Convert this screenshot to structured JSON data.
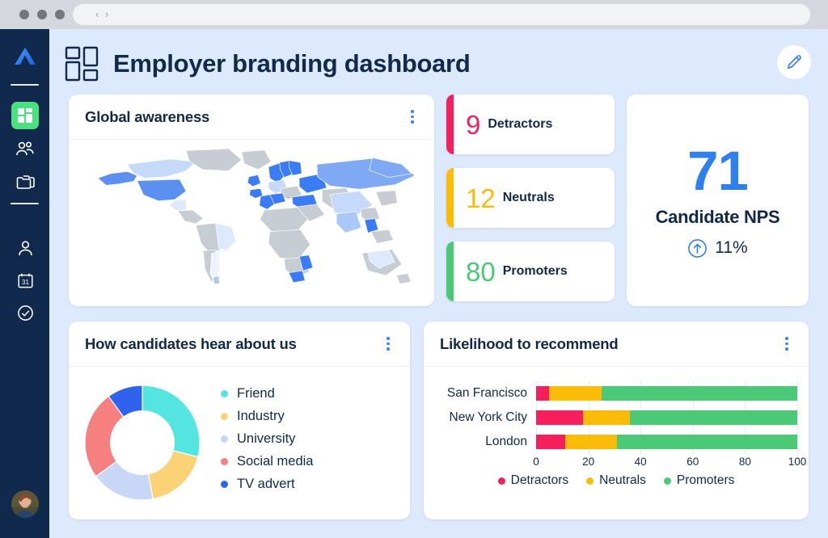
{
  "browser": {
    "nav_chevrons": "‹ ›",
    "window_dots": 3
  },
  "sidebar": {
    "logo_name": "app-logo",
    "items": [
      {
        "icon": "dashboard-grid-icon",
        "name": "dashboard",
        "active": true
      },
      {
        "icon": "people-icon",
        "name": "people",
        "active": false
      },
      {
        "icon": "folders-icon",
        "name": "folders",
        "active": false
      },
      {
        "icon": "person-icon",
        "name": "profile",
        "active": false
      },
      {
        "icon": "calendar-icon",
        "name": "calendar",
        "calendar_day": "31",
        "active": false
      },
      {
        "icon": "check-circle-icon",
        "name": "tasks",
        "active": false
      }
    ],
    "avatar_alt": "user-avatar"
  },
  "header": {
    "title": "Employer branding dashboard",
    "icon": "dashboard-grid-icon",
    "edit_icon": "pencil-icon"
  },
  "colors": {
    "detractors": "#f5록",
    "detractors_hex": "#f51f5e",
    "neutrals_hex": "#fbbc09",
    "promoters_hex": "#4cc977",
    "accent_blue": "#2f80ed",
    "navy": "#11294d",
    "canvas_bg": "#dde9fc",
    "sidebar_bg": "#11294d",
    "active_green": "#4ae07f"
  },
  "cards": {
    "global_awareness": {
      "title": "Global awareness",
      "menu": "kebab-menu"
    },
    "nps_summary": {
      "score": "71",
      "label": "Candidate NPS",
      "trend_icon": "arrow-up-circle-icon",
      "trend_value": "11%"
    },
    "hear_about_us": {
      "title": "How candidates hear about us",
      "menu": "kebab-menu"
    },
    "likelihood": {
      "title": "Likelihood to recommend",
      "menu": "kebab-menu"
    }
  },
  "nps_strips": [
    {
      "value": "9",
      "label": "Detractors",
      "color": "#f51f5e"
    },
    {
      "value": "12",
      "label": "Neutrals",
      "color": "#fbbc09"
    },
    {
      "value": "80",
      "label": "Promoters",
      "color": "#4cc977"
    }
  ],
  "chart_data": [
    {
      "type": "choropleth",
      "title": "Global awareness",
      "description": "World map shaded by awareness level",
      "no_data_color": "#c8cdd3",
      "scale_colors": [
        "#eef4fe",
        "#dde9fd",
        "#c5dafb",
        "#a9c8f8",
        "#7fa8f5",
        "#5b90f0",
        "#3a7cf5"
      ],
      "highlighted_regions": [
        {
          "region": "Russia",
          "level": "high"
        },
        {
          "region": "United States",
          "level": "high"
        },
        {
          "region": "Alaska",
          "level": "high"
        },
        {
          "region": "Norway",
          "level": "high"
        },
        {
          "region": "Sweden",
          "level": "high"
        },
        {
          "region": "Finland",
          "level": "high"
        },
        {
          "region": "United Kingdom",
          "level": "high"
        },
        {
          "region": "Ireland",
          "level": "high"
        },
        {
          "region": "France",
          "level": "high"
        },
        {
          "region": "Spain",
          "level": "high"
        },
        {
          "region": "Turkey",
          "level": "high"
        },
        {
          "region": "Ukraine",
          "level": "high"
        },
        {
          "region": "Canada",
          "level": "medium"
        },
        {
          "region": "Mexico",
          "level": "low"
        },
        {
          "region": "Brazil",
          "level": "low"
        },
        {
          "region": "Argentina",
          "level": "low"
        },
        {
          "region": "China",
          "level": "medium"
        },
        {
          "region": "India",
          "level": "medium"
        },
        {
          "region": "Thailand",
          "level": "high"
        },
        {
          "region": "Vietnam",
          "level": "high"
        },
        {
          "region": "South Africa",
          "level": "high"
        },
        {
          "region": "Mozambique",
          "level": "high"
        },
        {
          "region": "Australia",
          "level": "low"
        },
        {
          "region": "Greenland",
          "level": "none"
        },
        {
          "region": "Africa (most)",
          "level": "none"
        }
      ]
    },
    {
      "type": "pie",
      "subtype": "donut",
      "title": "How candidates hear about us",
      "categories": [
        "Friend",
        "Industry",
        "University",
        "Social media",
        "TV advert"
      ],
      "values": [
        29,
        18,
        18,
        25,
        10
      ],
      "colors": [
        "#54e5e0",
        "#fcd277",
        "#c7d7f5",
        "#f67f7f",
        "#2f63ed"
      ],
      "legend_position": "right",
      "inner_radius_ratio": 0.55
    },
    {
      "type": "bar",
      "subtype": "stacked-horizontal-100",
      "title": "Likelihood to recommend",
      "categories": [
        "San Francisco",
        "New York City",
        "London"
      ],
      "series": [
        {
          "name": "Detractors",
          "color": "#f51f5e",
          "values": [
            5,
            18,
            11
          ]
        },
        {
          "name": "Neutrals",
          "color": "#fbbc09",
          "values": [
            20,
            18,
            20
          ]
        },
        {
          "name": "Promoters",
          "color": "#4cc977",
          "values": [
            75,
            64,
            69
          ]
        }
      ],
      "xlabel": "",
      "ylabel": "",
      "xlim": [
        0,
        100
      ],
      "ticks": [
        "0",
        "20",
        "40",
        "60",
        "80",
        "100"
      ],
      "tick_values": [
        0,
        20,
        40,
        60,
        80,
        100
      ],
      "grid": true,
      "legend_position": "bottom"
    }
  ]
}
